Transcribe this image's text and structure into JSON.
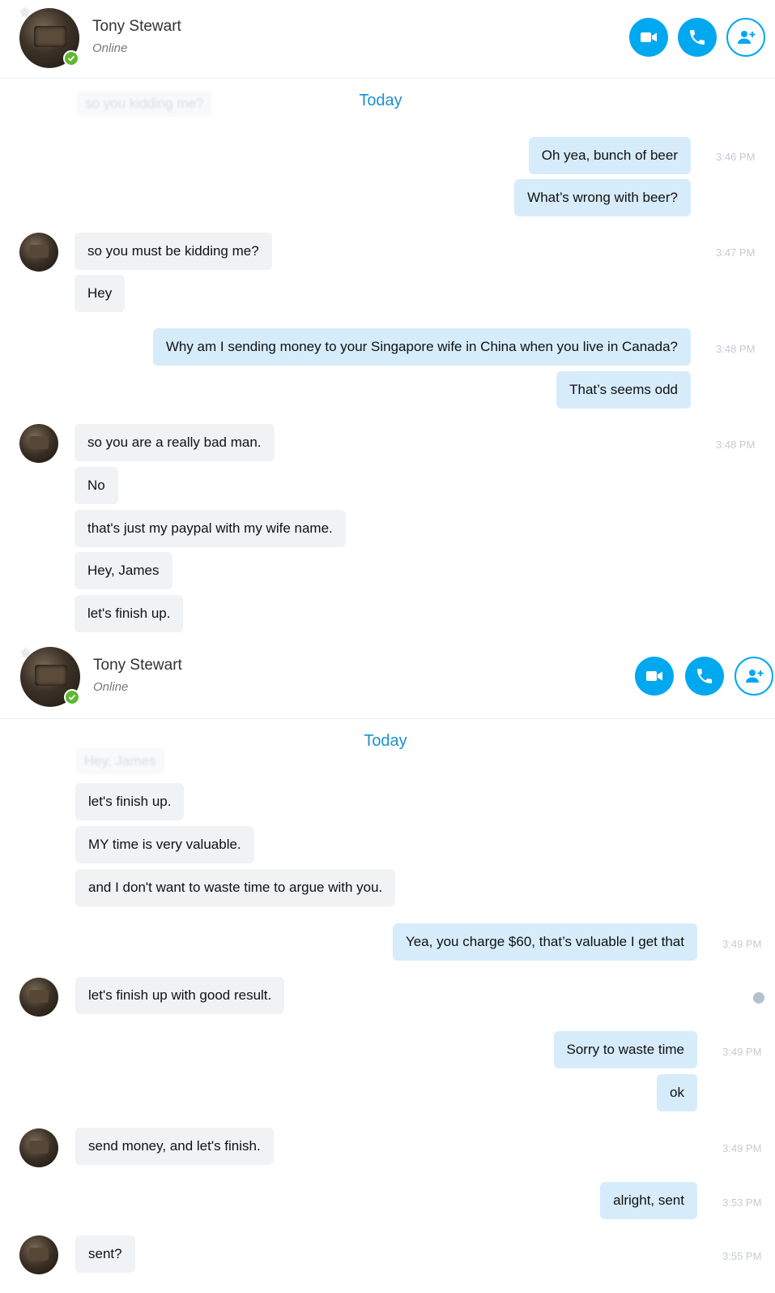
{
  "header": {
    "name": "Tony Stewart",
    "status": "Online",
    "buttons": [
      "video-call",
      "audio-call",
      "add-participant"
    ]
  },
  "colors": {
    "accent": "#00a8f0",
    "outgoing": "#d6ecfa",
    "incoming": "#f0f2f4",
    "online": "#5fb832"
  },
  "panel1": {
    "day_label": "Today",
    "ghost": "so you kidding me?",
    "messages": [
      {
        "text": "Oh yea, bunch of beer",
        "time": "3:46 PM"
      },
      {
        "text": "What’s wrong with beer?"
      },
      {
        "text": "so you must be kidding me?",
        "time": "3:47 PM"
      },
      {
        "text": "Hey"
      },
      {
        "text": "Why am I sending money to your Singapore wife in China when you live in Canada?",
        "time": "3:48 PM"
      },
      {
        "text": "That’s seems odd"
      },
      {
        "text": "so you are a really bad man.",
        "time": "3:48 PM"
      },
      {
        "text": "No"
      },
      {
        "text": "that's just my paypal with my wife name."
      },
      {
        "text": "Hey, James"
      },
      {
        "text": "let's finish up."
      }
    ]
  },
  "panel2": {
    "day_label": "Today",
    "ghost": "Hey, James",
    "messages": [
      {
        "text": "let's finish up."
      },
      {
        "text": "MY time is very valuable."
      },
      {
        "text": "and I don't want to waste time to argue with you."
      },
      {
        "text": "Yea, you charge $60, that’s valuable I get that",
        "time": "3:49 PM"
      },
      {
        "text": "let's finish up with good result."
      },
      {
        "text": "Sorry to waste time",
        "time": "3:49 PM"
      },
      {
        "text": "ok"
      },
      {
        "text": "send money, and let's finish.",
        "time": "3:49 PM"
      },
      {
        "text": "alright, sent",
        "time": "3:53 PM"
      },
      {
        "text": "sent?",
        "time": "3:55 PM"
      }
    ]
  }
}
